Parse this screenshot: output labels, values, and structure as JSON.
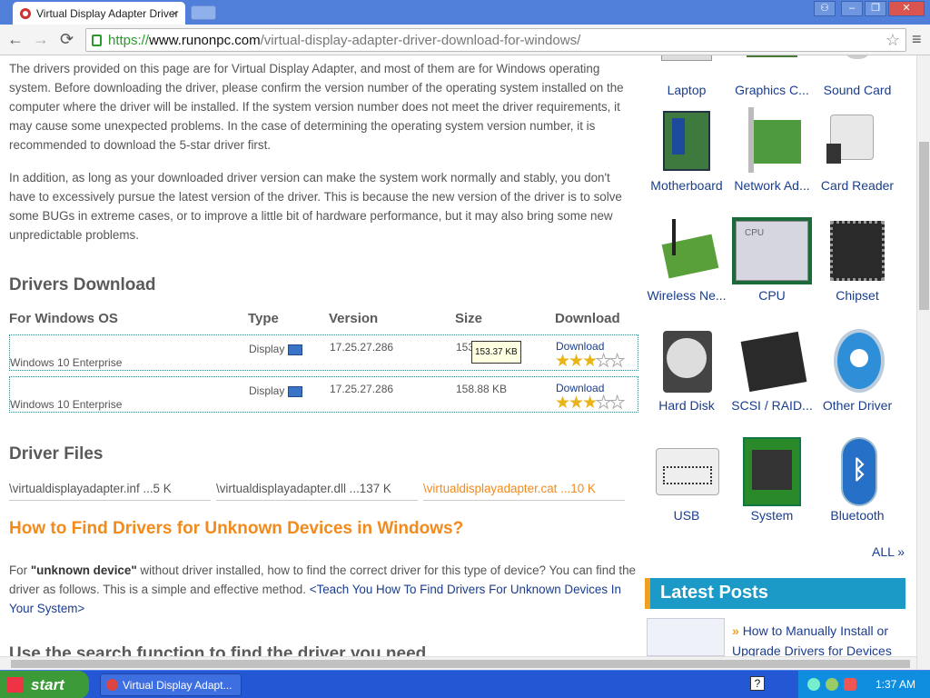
{
  "browser": {
    "tab_title": "Virtual Display Adapter Driver",
    "tab_close": "×",
    "scheme": "https://",
    "host": "www.runonpc.com",
    "path": "/virtual-display-adapter-driver-download-for-windows/",
    "nav_back": "←",
    "nav_forward": "→",
    "nav_reload": "⟳",
    "bookmark_star": "☆",
    "menu": "≡",
    "min": "–",
    "restore": "❐",
    "close": "✕",
    "user": "⚇"
  },
  "intro": {
    "p1": "The drivers provided on this page are for Virtual Display Adapter, and most of them are for Windows operating system. Before downloading the driver, please confirm the version number of the operating system installed on the computer where the driver will be installed. If the system version number does not meet the driver requirements, it may cause some unexpected problems. In the case of determining the operating system version number, it is recommended to download the 5-star driver first.",
    "p2": "In addition, as long as your downloaded driver version can make the system work normally and stably, you don't have to excessively pursue the latest version of the driver. This is because the new version of the driver is to solve some BUGs in extreme cases, or to improve a little bit of hardware performance, but it may also bring some new unpredictable problems."
  },
  "downloads": {
    "heading": "Drivers Download",
    "headers": {
      "os": "For Windows OS",
      "type": "Type",
      "version": "Version",
      "size": "Size",
      "download": "Download"
    },
    "rows": [
      {
        "os": "Windows 10 Enterprise",
        "type": "Display",
        "version": "17.25.27.286",
        "size": "153.37 KB",
        "download": "Download",
        "stars": "★★★☆☆"
      },
      {
        "os": "Windows 10 Enterprise",
        "type": "Display",
        "version": "17.25.27.286",
        "size": "158.88 KB",
        "download": "Download",
        "stars": "★★★☆☆"
      }
    ],
    "tooltip": "153.37 KB"
  },
  "files": {
    "heading": "Driver Files",
    "items": [
      "\\virtualdisplayadapter.inf ...5 K",
      "\\virtualdisplayadapter.dll ...137 K",
      "\\virtualdisplayadapter.cat ...10 K"
    ]
  },
  "howto": {
    "heading": "How to Find Drivers for Unknown Devices in Windows?",
    "p_before": "For ",
    "p_bold": "\"unknown device\"",
    "p_after": " without driver installed, how to find the correct driver for this type of device? You can find the driver as follows. This is a simple and effective method. ",
    "p_link": "<Teach You How To Find Drivers For Unknown Devices In Your System>",
    "cut_heading": "Use the search function to find the driver you need"
  },
  "sidebar": {
    "devices": [
      "Laptop",
      "Graphics C...",
      "Sound Card",
      "Motherboard",
      "Network Ad...",
      "Card Reader",
      "Wireless Ne...",
      "CPU",
      "Chipset",
      "Hard Disk",
      "SCSI / RAID...",
      "Other Driver",
      "USB",
      "System",
      "Bluetooth"
    ],
    "all": "ALL »",
    "latest_posts": "Latest Posts",
    "post1_arrow": "»",
    "post1": "How to Manually Install or Upgrade Drivers for Devices"
  },
  "taskbar": {
    "start": "start",
    "task": "Virtual Display Adapt...",
    "clock": "1:37 AM",
    "help": "?"
  }
}
